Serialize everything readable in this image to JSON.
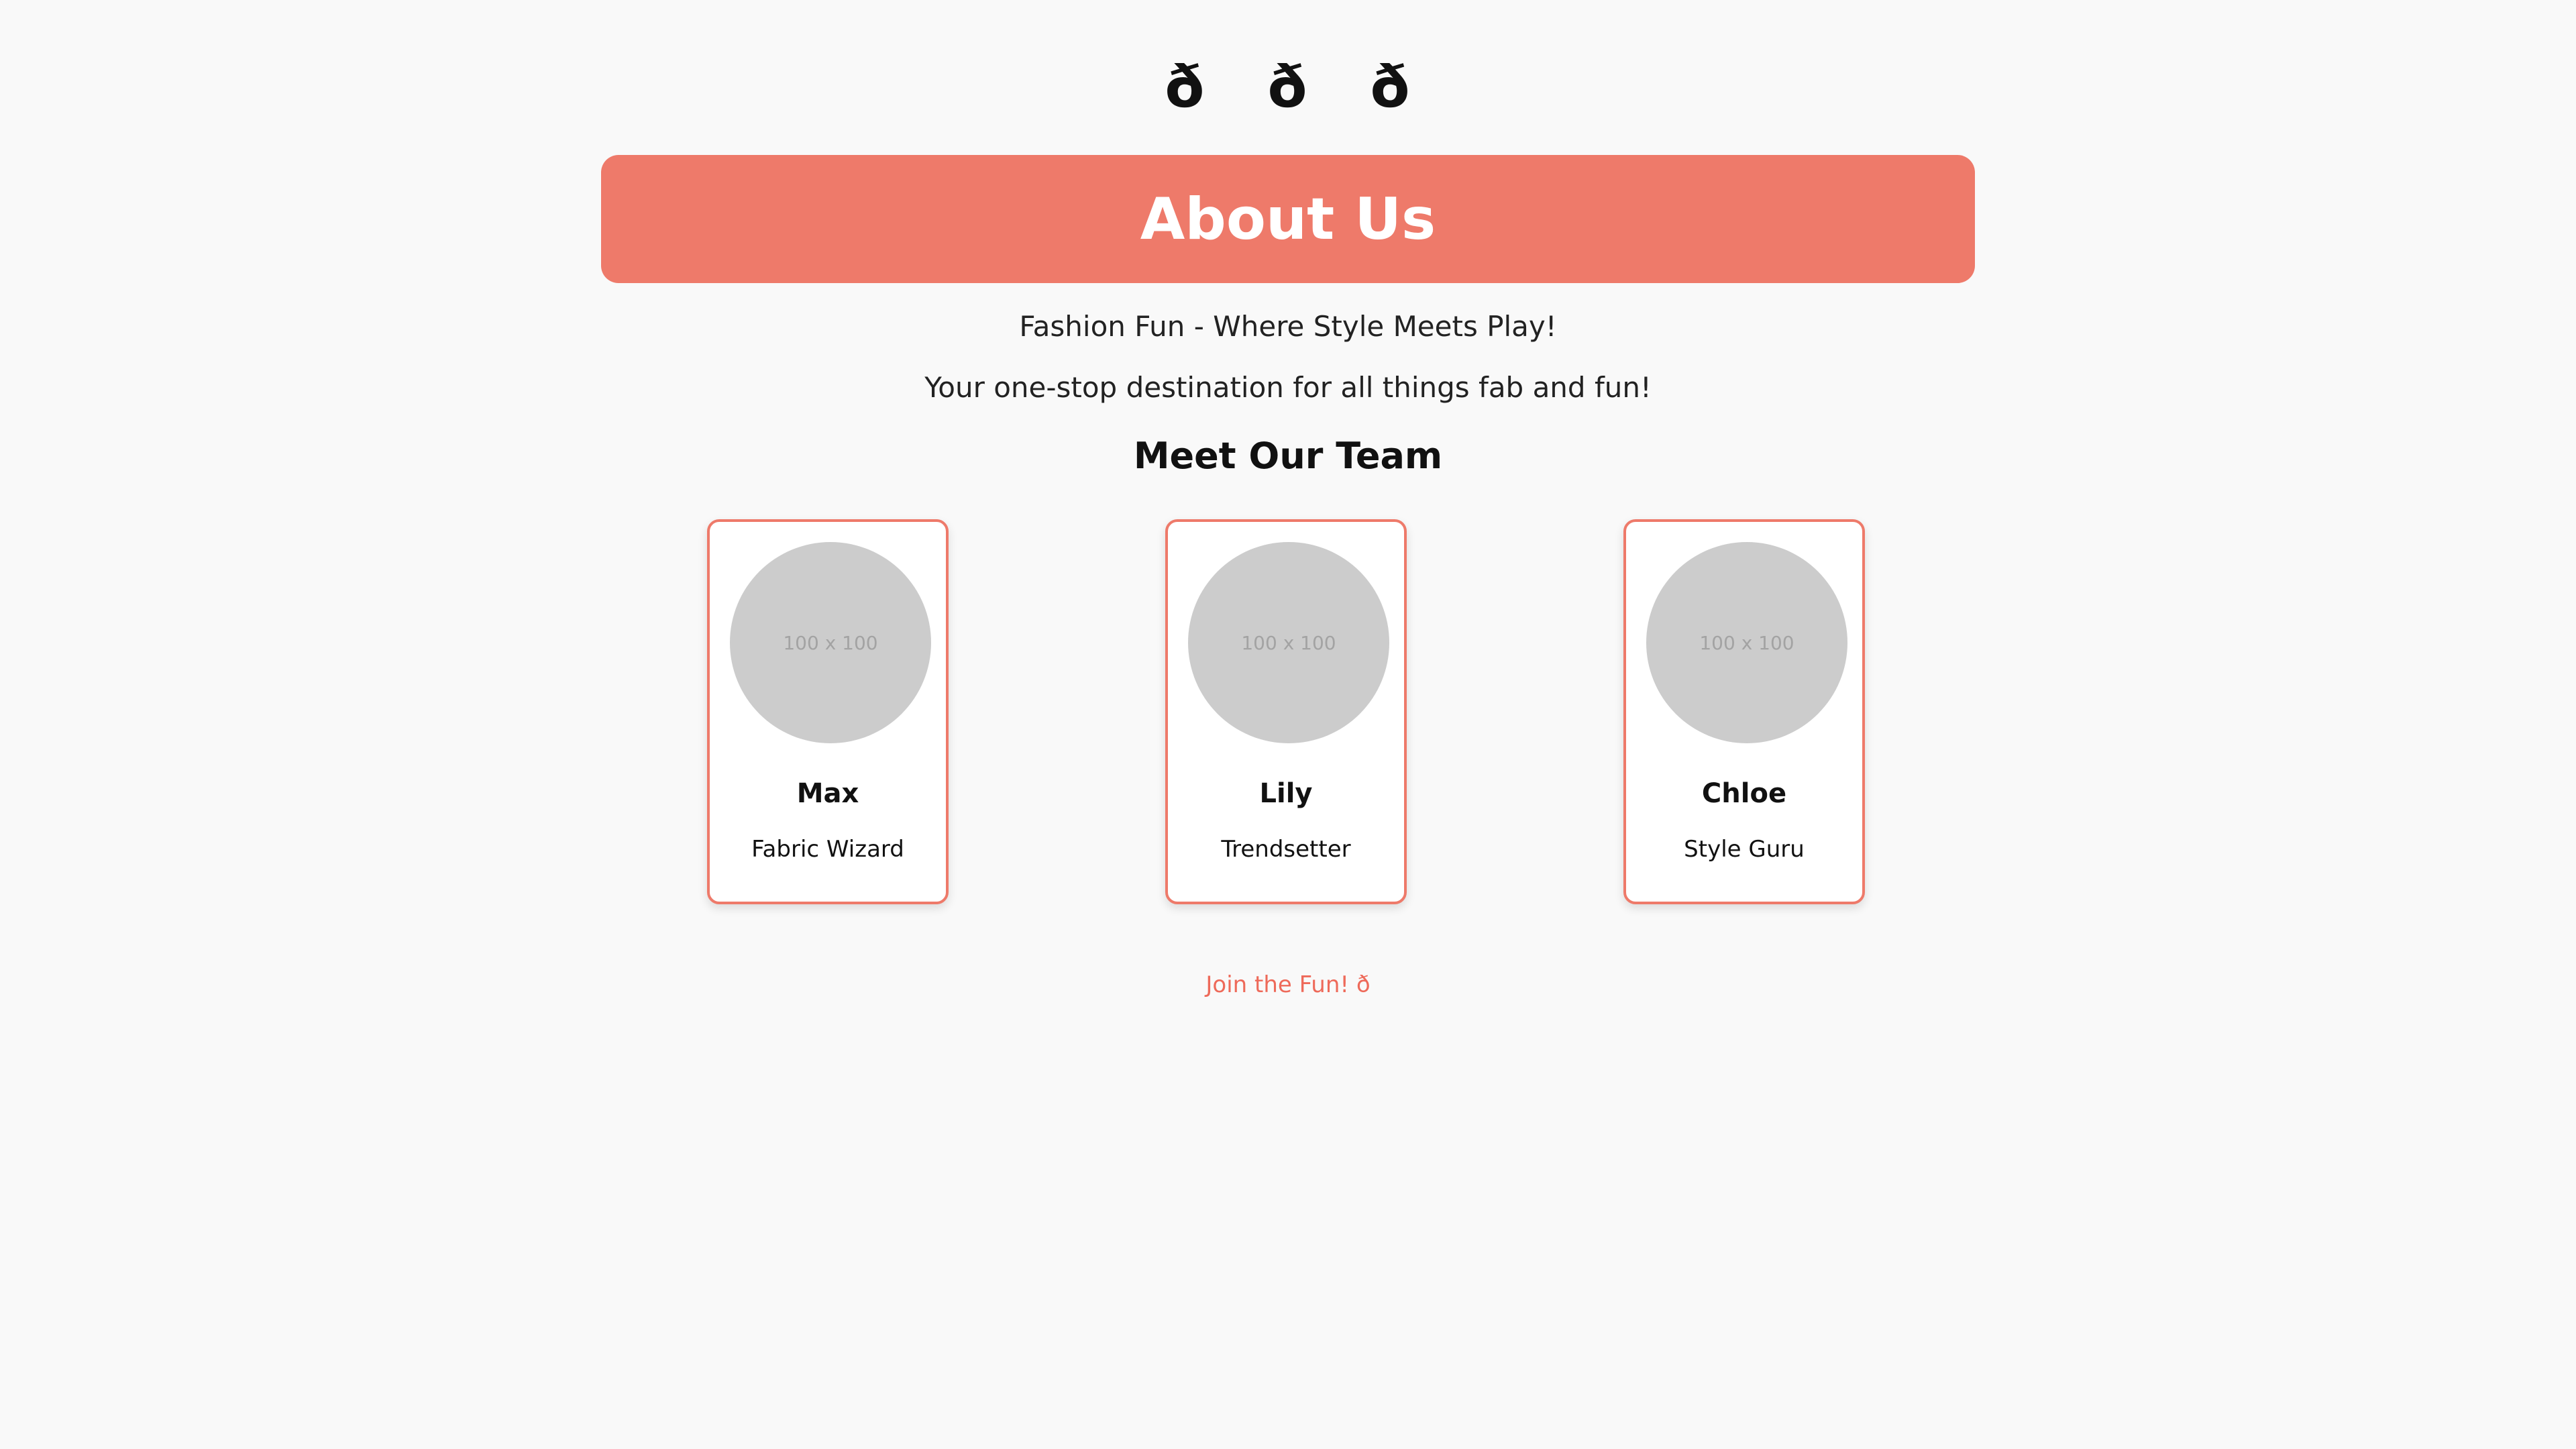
{
  "nav": {
    "items": [
      "ð",
      "ð",
      "ð"
    ]
  },
  "banner": {
    "title": "About Us"
  },
  "intro": {
    "tagline": "Fashion Fun - Where Style Meets Play!",
    "subtitle": "Your one-stop destination for all things fab and fun!"
  },
  "team": {
    "heading": "Meet Our Team",
    "members": [
      {
        "avatar_text": "100 x 100",
        "name": "Max",
        "role": "Fabric Wizard"
      },
      {
        "avatar_text": "100 x 100",
        "name": "Lily",
        "role": "Trendsetter"
      },
      {
        "avatar_text": "100 x 100",
        "name": "Chloe",
        "role": "Style Guru"
      }
    ]
  },
  "footer": {
    "link_label": "Join the Fun! ð"
  },
  "colors": {
    "accent": "#ee7a6a",
    "background": "#f9f9f9",
    "avatar_placeholder": "#cccccc"
  }
}
